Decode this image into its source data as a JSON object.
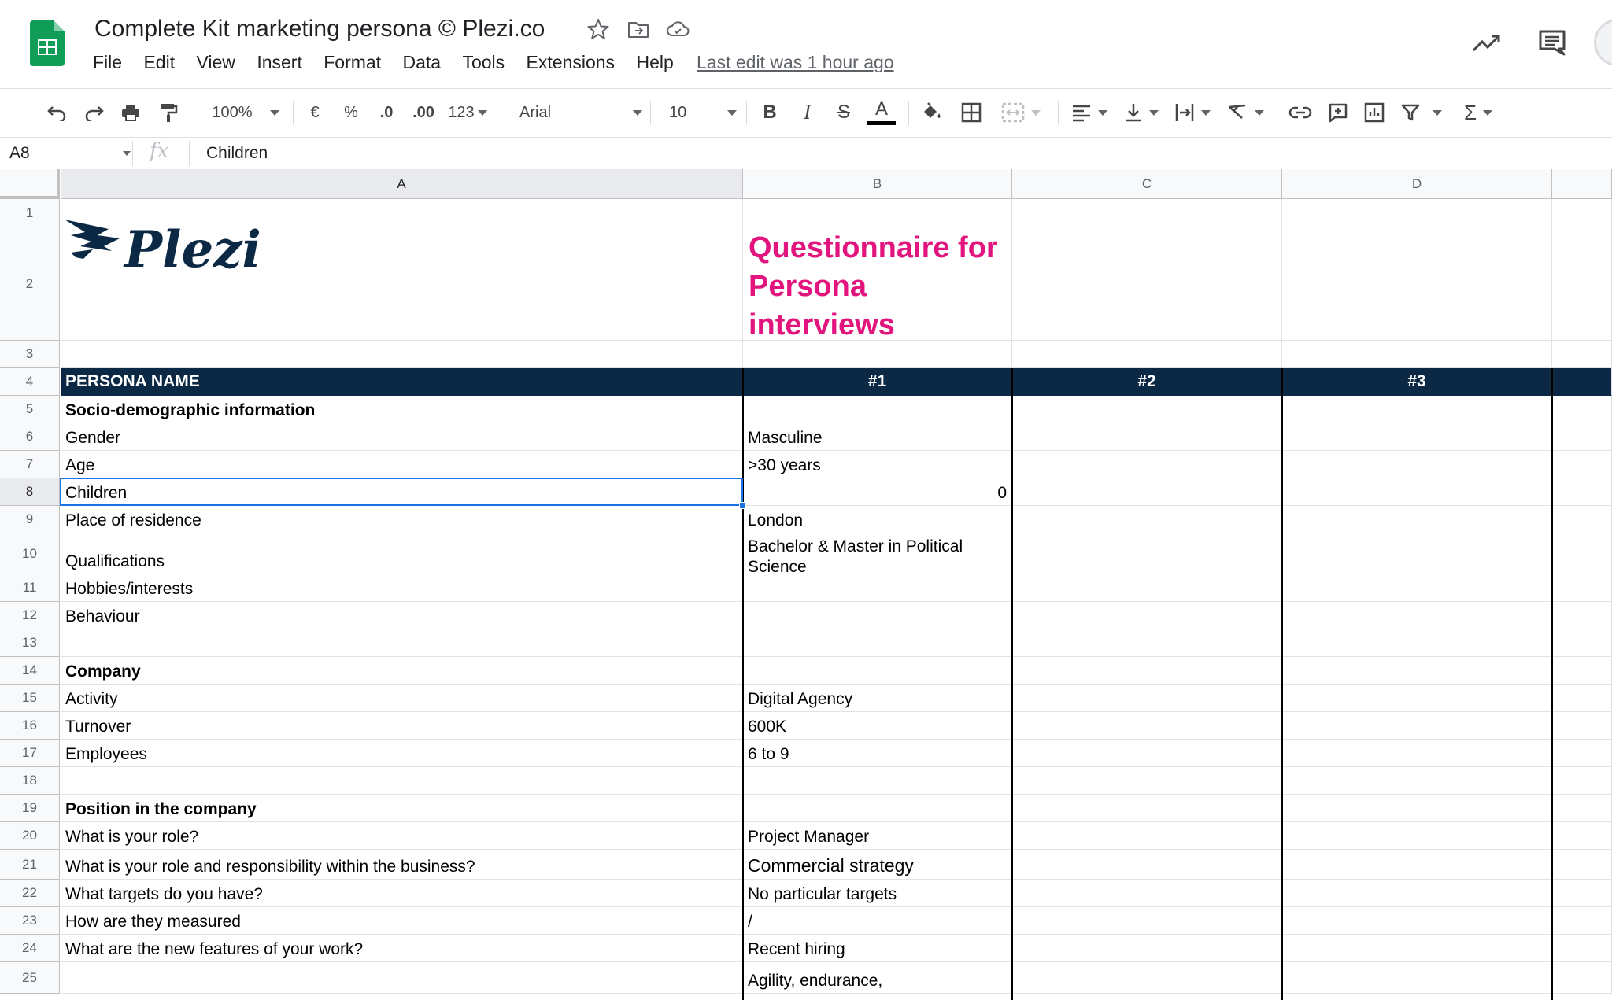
{
  "titlebar": {
    "doc_title": "Complete Kit marketing persona © Plezi.co",
    "menu": [
      "File",
      "Edit",
      "View",
      "Insert",
      "Format",
      "Data",
      "Tools",
      "Extensions",
      "Help"
    ],
    "last_edit": "Last edit was 1 hour ago"
  },
  "toolbar": {
    "zoom": "100%",
    "currency": "€",
    "percent": "%",
    "decrease_decimals": ".0",
    "increase_decimals": ".00",
    "more_formats": "123",
    "font": "Arial",
    "font_size": "10",
    "bold": "B",
    "italic": "I",
    "strike": "S",
    "text_color": "A",
    "sum": "Σ"
  },
  "formula_bar": {
    "cell_ref": "A8",
    "fx": "fx",
    "value": "Children"
  },
  "grid": {
    "columns": [
      "A",
      "B",
      "C",
      "D"
    ],
    "active_column": "A",
    "active_row": "8",
    "logo_text": "Plezi",
    "title": "Questionnaire for Persona interviews",
    "header": {
      "label": "PERSONA NAME",
      "p1": "#1",
      "p2": "#2",
      "p3": "#3"
    },
    "rows": [
      {
        "n": "1",
        "a": "",
        "b": ""
      },
      {
        "n": "2",
        "a": "",
        "b": ""
      },
      {
        "n": "3",
        "a": "",
        "b": ""
      },
      {
        "n": "4",
        "a": "",
        "b": ""
      },
      {
        "n": "5",
        "a": "Socio-demographic information",
        "b": ""
      },
      {
        "n": "6",
        "a": "Gender",
        "b": "Masculine"
      },
      {
        "n": "7",
        "a": "Age",
        "b": ">30 years"
      },
      {
        "n": "8",
        "a": "Children",
        "b": "0"
      },
      {
        "n": "9",
        "a": "Place of residence",
        "b": "London"
      },
      {
        "n": "10",
        "a": "Qualifications",
        "b": "Bachelor & Master in Political Science"
      },
      {
        "n": "11",
        "a": "Hobbies/interests",
        "b": ""
      },
      {
        "n": "12",
        "a": "Behaviour",
        "b": ""
      },
      {
        "n": "13",
        "a": "",
        "b": ""
      },
      {
        "n": "14",
        "a": "Company",
        "b": ""
      },
      {
        "n": "15",
        "a": "Activity",
        "b": "Digital Agency"
      },
      {
        "n": "16",
        "a": "Turnover",
        "b": "600K"
      },
      {
        "n": "17",
        "a": "Employees",
        "b": "6 to 9"
      },
      {
        "n": "18",
        "a": "",
        "b": ""
      },
      {
        "n": "19",
        "a": "Position in the company",
        "b": ""
      },
      {
        "n": "20",
        "a": "What is your role?",
        "b": "Project Manager"
      },
      {
        "n": "21",
        "a": "What is your role and responsibility within the business?",
        "b": "Commercial strategy"
      },
      {
        "n": "22",
        "a": "What targets do you have?",
        "b": "No particular targets"
      },
      {
        "n": "23",
        "a": "How are they measured",
        "b": "/"
      },
      {
        "n": "24",
        "a": "What are the new features of your work?",
        "b": "Recent hiring"
      },
      {
        "n": "25",
        "a": "",
        "b": "Agility, endurance,"
      }
    ]
  },
  "colors": {
    "header_bg": "#0b2944",
    "title_pink": "#e1157d",
    "selection_blue": "#1a73e8",
    "sheets_green": "#0f9d58"
  }
}
